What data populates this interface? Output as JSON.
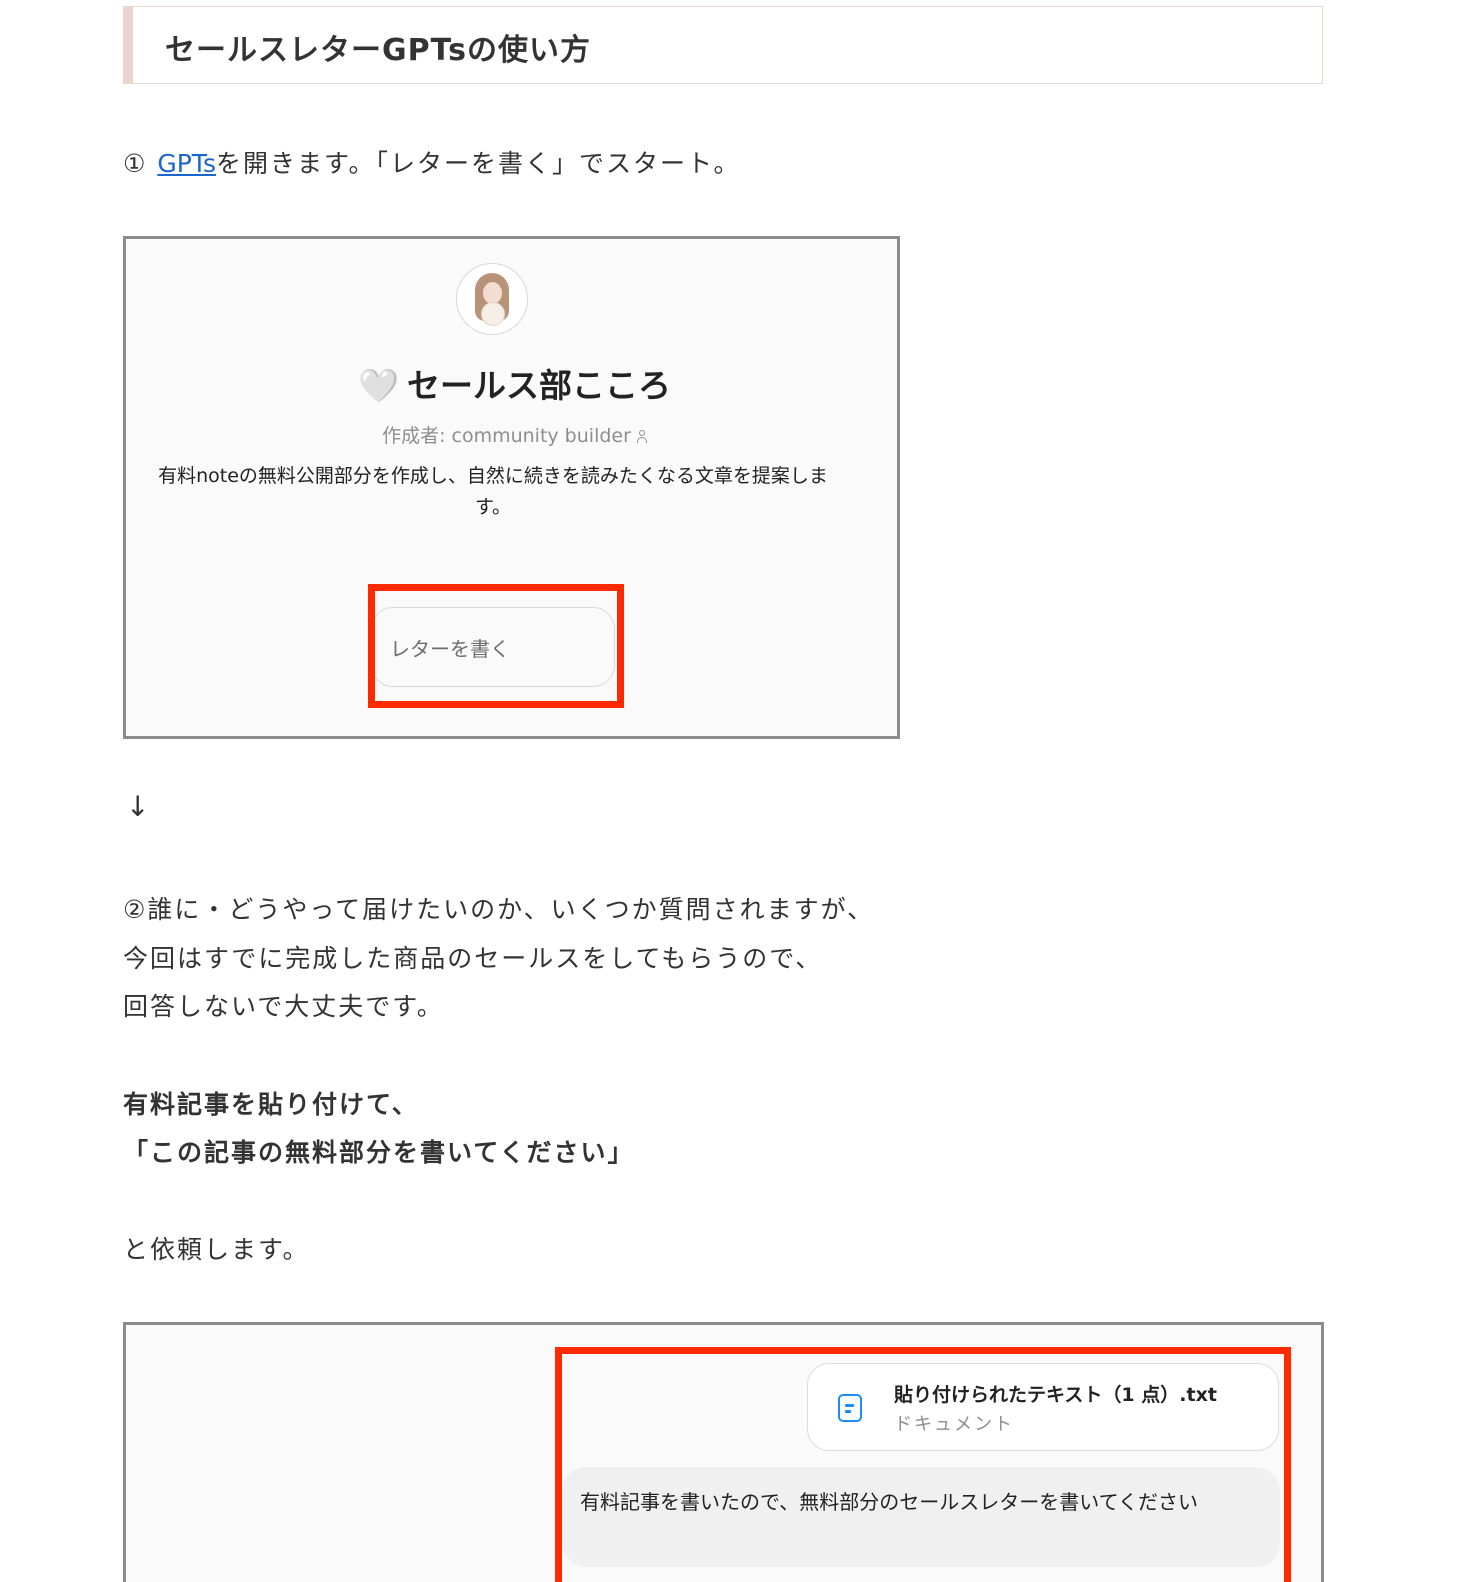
{
  "section_heading": "セールスレターGPTsの使い方",
  "step1": {
    "prefix": "① ",
    "link_text": "GPTs",
    "suffix": "を開きます。「レターを書く」でスタート。"
  },
  "gpt_screen": {
    "heart": "🤍",
    "name": "セールス部こころ",
    "author": "作成者: community builder",
    "description": "有料noteの無料公開部分を作成し、自然に続きを読みたくなる文章を提案します。",
    "starter_button": "レターを書く"
  },
  "arrow": "↓",
  "step2_lines": [
    "②誰に・どうやって届けたいのか、いくつか質問されますが、",
    "今回はすでに完成した商品のセールスをしてもらうので、",
    "回答しないで大丈夫です。"
  ],
  "instruction_lines": [
    "有料記事を貼り付けて、",
    "「この記事の無料部分を書いてください」"
  ],
  "closing": "と依頼します。",
  "chat_screen": {
    "file_name": "貼り付けられたテキスト（1 点）.txt",
    "file_type": "ドキュメント",
    "message": "有料記事を書いたので、無料部分のセールスレターを書いてください"
  },
  "colors": {
    "link": "#1a66cc",
    "highlight": "#ff2a00",
    "heading_accent": "#ead4cc",
    "file_icon": "#1a8cff"
  }
}
